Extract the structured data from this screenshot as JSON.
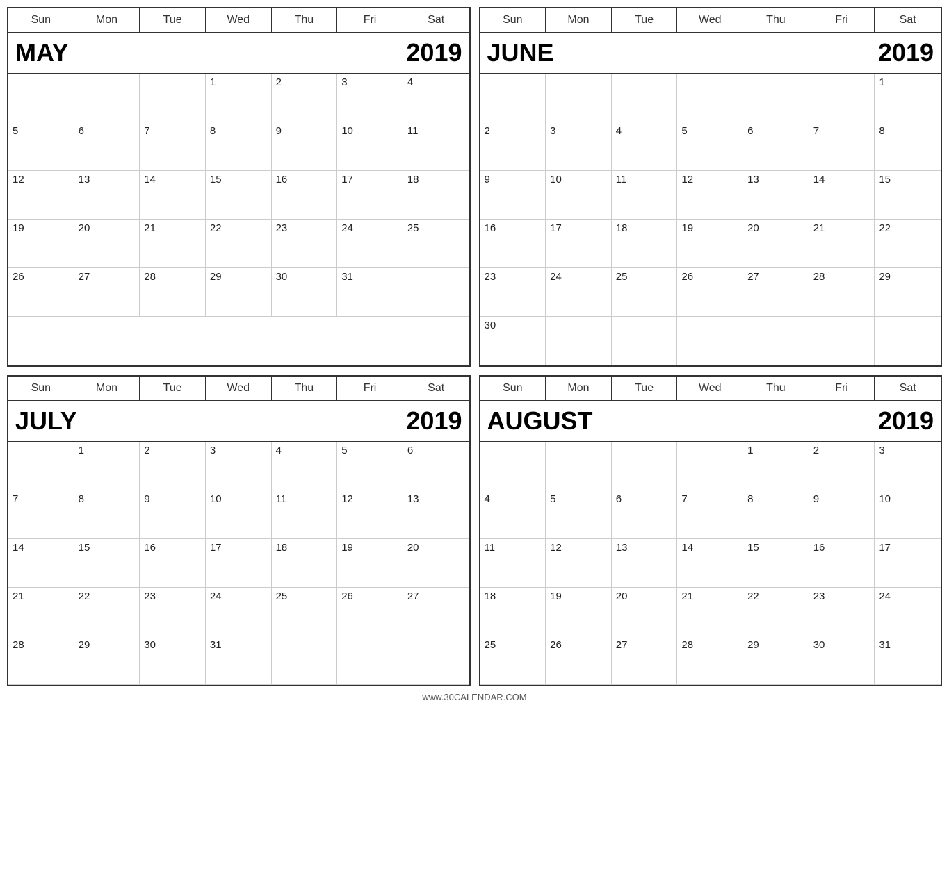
{
  "footer": "www.30CALENDAR.COM",
  "calendars": [
    {
      "id": "may-2019",
      "month": "MAY",
      "year": "2019",
      "dayHeaders": [
        "Sun",
        "Mon",
        "Tue",
        "Wed",
        "Thu",
        "Fri",
        "Sat"
      ],
      "startDay": 3,
      "totalDays": 31
    },
    {
      "id": "june-2019",
      "month": "JUNE",
      "year": "2019",
      "dayHeaders": [
        "Sun",
        "Mon",
        "Tue",
        "Wed",
        "Thu",
        "Fri",
        "Sat"
      ],
      "startDay": 6,
      "totalDays": 30
    },
    {
      "id": "july-2019",
      "month": "JULY",
      "year": "2019",
      "dayHeaders": [
        "Sun",
        "Mon",
        "Tue",
        "Wed",
        "Thu",
        "Fri",
        "Sat"
      ],
      "startDay": 1,
      "totalDays": 31
    },
    {
      "id": "august-2019",
      "month": "AUGUST",
      "year": "2019",
      "dayHeaders": [
        "Sun",
        "Mon",
        "Tue",
        "Wed",
        "Thu",
        "Fri",
        "Sat"
      ],
      "startDay": 4,
      "totalDays": 31
    }
  ]
}
